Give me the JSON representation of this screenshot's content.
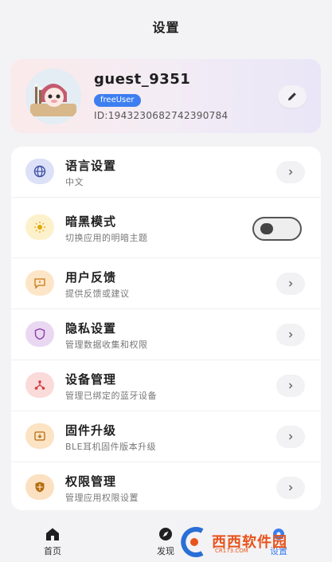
{
  "header": {
    "title": "设置"
  },
  "profile": {
    "username": "guest_9351",
    "badge": "freeUser",
    "id_text": "ID:1943230682742390784"
  },
  "settings": [
    {
      "title": "语言设置",
      "subtitle": "中文",
      "icon": "globe-icon",
      "icon_bg": "#dde1f7",
      "icon_color": "#3d4fa6",
      "control": "chevron"
    },
    {
      "title": "暗黑模式",
      "subtitle": "切换应用的明暗主题",
      "icon": "sun-icon",
      "icon_bg": "#fdf1cc",
      "icon_color": "#e0a800",
      "control": "toggle",
      "toggle_on": false
    },
    {
      "title": "用户反馈",
      "subtitle": "提供反馈或建议",
      "icon": "feedback-icon",
      "icon_bg": "#fde6c8",
      "icon_color": "#c57a14",
      "control": "chevron"
    },
    {
      "title": "隐私设置",
      "subtitle": "管理数据收集和权限",
      "icon": "shield-icon",
      "icon_bg": "#ead8f2",
      "icon_color": "#8a3ea8",
      "control": "chevron"
    },
    {
      "title": "设备管理",
      "subtitle": "管理已绑定的蓝牙设备",
      "icon": "device-share-icon",
      "icon_bg": "#fbdada",
      "icon_color": "#d23b3b",
      "control": "chevron"
    },
    {
      "title": "固件升级",
      "subtitle": "BLE耳机固件版本升级",
      "icon": "firmware-upload-icon",
      "icon_bg": "#fbe3c4",
      "icon_color": "#b56d10",
      "control": "chevron"
    },
    {
      "title": "权限管理",
      "subtitle": "管理应用权限设置",
      "icon": "permission-shield-icon",
      "icon_bg": "#fbe1c2",
      "icon_color": "#b56d10",
      "control": "chevron"
    }
  ],
  "bottom_nav": [
    {
      "label": "首页",
      "icon": "home-icon"
    },
    {
      "label": "发现",
      "icon": "compass-icon"
    },
    {
      "label": "设置",
      "icon": "settings-icon",
      "active": true
    }
  ],
  "watermark": {
    "text": "西西软件园",
    "sub": "CR173.COM"
  },
  "colors": {
    "accent": "#3d7ef0",
    "background": "#f3f3f5",
    "card": "#ffffff"
  }
}
